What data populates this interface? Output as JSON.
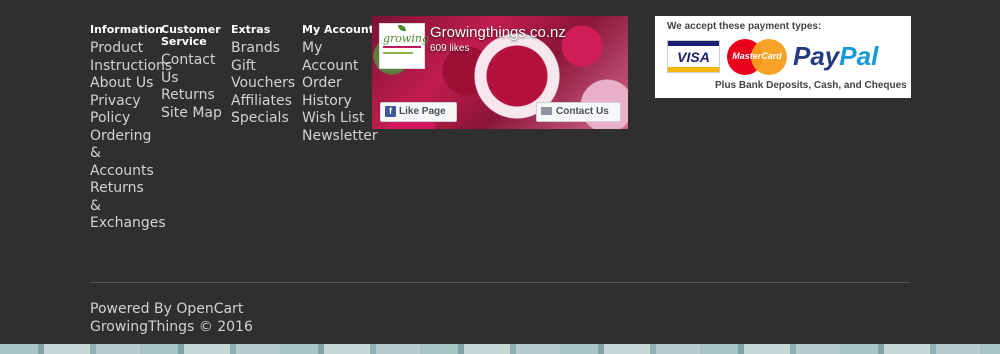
{
  "columns": [
    {
      "heading": "Information",
      "links": [
        "Product Instructions",
        "About Us",
        "Privacy Policy",
        "Ordering & Accounts",
        "Returns & Exchanges"
      ]
    },
    {
      "heading": "Customer Service",
      "links": [
        "Contact Us",
        "Returns",
        "Site Map"
      ]
    },
    {
      "heading": "Extras",
      "links": [
        "Brands",
        "Gift Vouchers",
        "Affiliates",
        "Specials"
      ]
    },
    {
      "heading": "My Account",
      "links": [
        "My Account",
        "Order History",
        "Wish List",
        "Newsletter"
      ]
    }
  ],
  "facebook": {
    "page_name": "Growingthings.co.nz",
    "likes": "609 likes",
    "logo_text": "growing",
    "like_button": "Like Page",
    "contact_button": "Contact Us"
  },
  "payment": {
    "heading": "We accept these payment types:",
    "visa": "VISA",
    "mastercard": "MasterCard",
    "paypal_a": "Pay",
    "paypal_b": "Pal",
    "footnote": "Plus Bank Deposits, Cash, and Cheques"
  },
  "powered": {
    "prefix": "Powered By ",
    "link": "OpenCart"
  },
  "copyright": "GrowingThings © 2016"
}
